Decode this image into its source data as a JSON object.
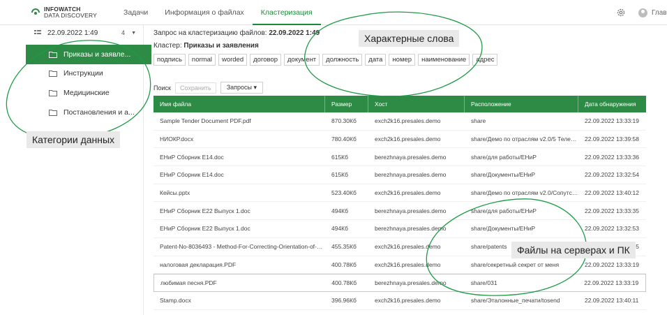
{
  "header": {
    "logo_line1": "INFOWATCH",
    "logo_line2": "DATA DISCOVERY",
    "tabs": [
      {
        "label": "Задачи"
      },
      {
        "label": "Информация о файлах"
      },
      {
        "label": "Кластеризация"
      }
    ],
    "active_tab": 2,
    "user": "Глав"
  },
  "sidebar": {
    "date": "22.09.2022 1:49",
    "count": "4",
    "items": [
      {
        "label": "Приказы и заявле..."
      },
      {
        "label": "Инструкции"
      },
      {
        "label": "Медицинские"
      },
      {
        "label": "Постановления и а..."
      }
    ]
  },
  "main": {
    "query_label": "Запрос на кластеризацию файлов:",
    "query_value": "22.09.2022 1:49",
    "cluster_label": "Кластер:",
    "cluster_value": "Приказы и заявления",
    "tags": [
      "подпись",
      "normal",
      "worded",
      "договор",
      "документ",
      "должность",
      "дата",
      "номер",
      "наименование",
      "адрес"
    ],
    "toolbar": {
      "search": "Поиск",
      "save": "Сохранить",
      "queries": "Запросы ▾"
    },
    "table": {
      "columns": [
        "Имя файла",
        "Размер",
        "Хост",
        "Расположение",
        "Дата обнаружения"
      ],
      "rows": [
        [
          "Sample Tender Document PDF.pdf",
          "870.30Кб",
          "exch2k16.presales.demo",
          "share",
          "22.09.2022 13:33:19"
        ],
        [
          "НИОКР.docx",
          "780.40Кб",
          "exch2k16.presales.demo",
          "share/Демо по отраслям v2.0/5 Телеко...",
          "22.09.2022 13:39:58"
        ],
        [
          "ЕНиР Сборник Е14.doc",
          "615Кб",
          "berezhnaya.presales.demo",
          "share/для работы/ЕНиР",
          "22.09.2022 13:33:36"
        ],
        [
          "ЕНиР Сборник Е14.doc",
          "615Кб",
          "berezhnaya.presales.demo",
          "share/Документы/ЕНиР",
          "22.09.2022 13:32:54"
        ],
        [
          "Кейсы.pptx",
          "523.40Кб",
          "exch2k16.presales.demo",
          "share/Демо по отраслям v2.0/Сопутств...",
          "22.09.2022 13:40:12"
        ],
        [
          "ЕНиР Сборник Е22 Выпуск 1.doc",
          "494Кб",
          "berezhnaya.presales.demo",
          "share/для работы/ЕНиР",
          "22.09.2022 13:33:35"
        ],
        [
          "ЕНиР Сборник Е22 Выпуск 1.doc",
          "494Кб",
          "berezhnaya.presales.demo",
          "share/Документы/ЕНиР",
          "22.09.2022 13:32:53"
        ],
        [
          "Patent-No-8036493 - Method-For-Correcting-Orientation-of-Pate...",
          "455.35Кб",
          "exch2k16.presales.demo",
          "share/patents",
          "22.09.2022 13:39:45"
        ],
        [
          "налоговая декларация.PDF",
          "400.78Кб",
          "exch2k16.presales.demo",
          "share/секретный секрет от меня",
          "22.09.2022 13:33:19"
        ],
        [
          "любимая песня.PDF",
          "400.78Кб",
          "berezhnaya.presales.demo",
          "share/031",
          "22.09.2022 13:33:19"
        ],
        [
          "Stamp.docx",
          "396.96Кб",
          "exch2k16.presales.demo",
          "share/Эталонные_печати/tosend",
          "22.09.2022 13:40:11"
        ]
      ],
      "highlighted_row": 9
    }
  },
  "annotations": {
    "keywords": "Характерные слова",
    "categories": "Категории данных",
    "files": "Файлы на серверах и ПК"
  },
  "colors": {
    "accent": "#2e8b45",
    "annotation_line": "#1e9b46"
  }
}
